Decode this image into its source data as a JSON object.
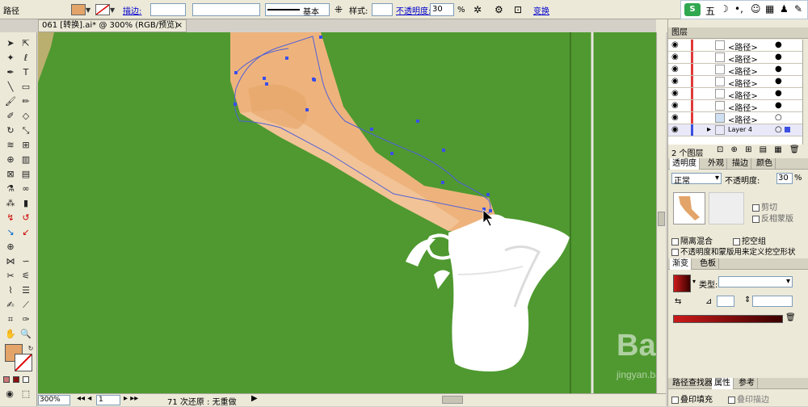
{
  "control_bar": {
    "object_type": "路径",
    "stroke_label": "描边:",
    "stroke_profile": "基本",
    "style_label": "样式:",
    "opacity_label": "不透明度:",
    "opacity_value": "30",
    "opacity_unit": "%",
    "transform_label": "变换",
    "fill_color": "#e3a469"
  },
  "sogou": {
    "label": "五",
    "logo": "S"
  },
  "document": {
    "tab_title": "061 [转换].ai* @ 300% (RGB/预览)",
    "close": "×",
    "background_color": "#4f9930"
  },
  "status": {
    "zoom": "300%",
    "page": "1",
    "info": "71 次还原 : 无重做"
  },
  "layers_panel": {
    "title": "图层",
    "footer": "2 个图层",
    "rows": [
      {
        "name": "<路径>"
      },
      {
        "name": "<路径>"
      },
      {
        "name": "<路径>"
      },
      {
        "name": "<路径>"
      },
      {
        "name": "<路径>"
      },
      {
        "name": "<路径>"
      },
      {
        "name": "<路径>"
      },
      {
        "name": "Layer 4"
      }
    ]
  },
  "transparency_panel": {
    "tabs": [
      "透明度",
      "外观",
      "描边",
      "颜色"
    ],
    "blend_mode": "正常",
    "opacity_label": "不透明度:",
    "opacity_value": "30",
    "opacity_unit": "%",
    "clip": "剪切",
    "invert_mask": "反相蒙版",
    "isolate_blending": "隔离混合",
    "knockout_group": "挖空组",
    "opacity_mask_shape": "不透明度和蒙版用来定义挖空形状"
  },
  "gradient_panel": {
    "tabs": [
      "渐变",
      "色板"
    ],
    "type_label": "类型:",
    "colors": {
      "start": "#cc1a1a",
      "end": "#3a0000"
    }
  },
  "bottom_panel": {
    "tabs": [
      "路径查找器",
      "属性",
      "参考"
    ],
    "overprint_fill": "叠印填充",
    "overprint_stroke": "叠印描边"
  },
  "watermark": {
    "brand": "Bai 经验",
    "url": "jingyan.baidu.com"
  }
}
